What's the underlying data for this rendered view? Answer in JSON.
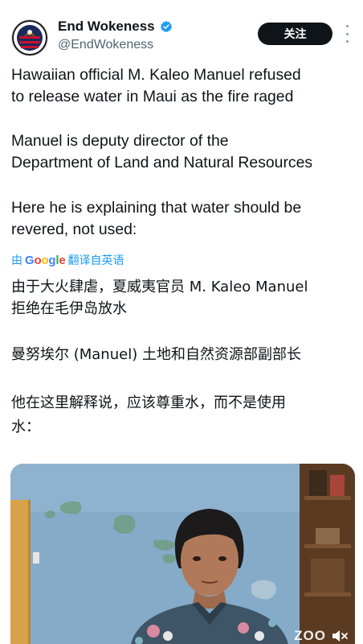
{
  "post": {
    "author_name": "End Wokeness",
    "author_handle": "@EndWokeness",
    "follow_label": "关注",
    "verified_color": "#1d9bf0",
    "avatar_icon": "eagle-flag-avatar",
    "text_en": {
      "line1a": "Hawaiian official M. Kaleo Manuel refused",
      "line1b": "to release water in Maui as the fire raged",
      "line2a": "Manuel is deputy director of the",
      "line2b": "Department of Land and Natural Resources",
      "line3a": "Here he is explaining that water should be",
      "line3b": "revered, not used:"
    },
    "translate": {
      "prefix": "由",
      "brand": "Google",
      "suffix": "翻译自英语"
    },
    "text_zh": {
      "line1a": "由于大火肆虐，夏威夷官员 M. Kaleo Manuel",
      "line1b": "拒绝在毛伊岛放水",
      "line2": "曼努埃尔 (Manuel) 土地和自然资源部副部长",
      "line3a": "他在这里解释说，应该尊重水，而不是使用",
      "line3b": "水："
    },
    "media": {
      "watermark": "ZOO",
      "mute_icon": "speaker-muted-icon"
    }
  }
}
